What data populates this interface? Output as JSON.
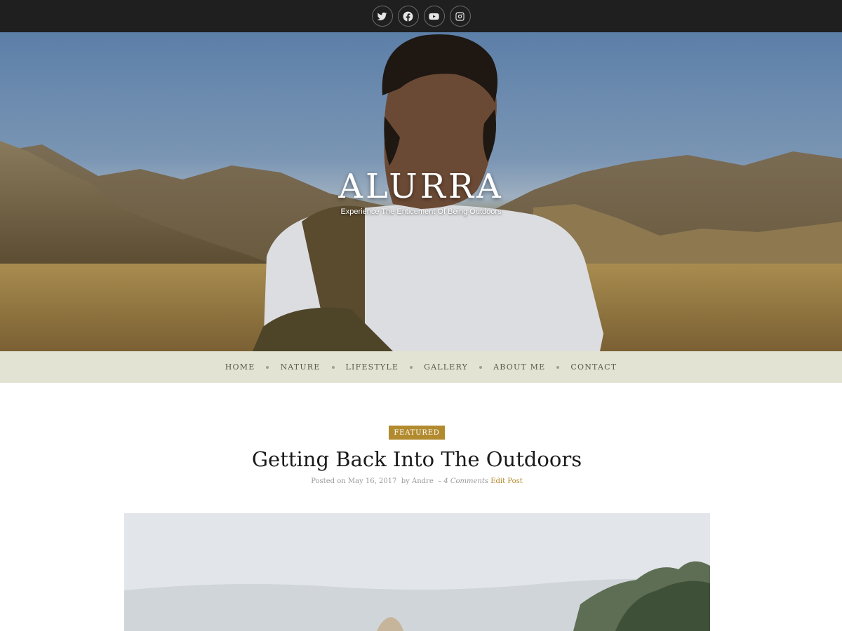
{
  "social": [
    {
      "name": "twitter-icon"
    },
    {
      "name": "facebook-icon"
    },
    {
      "name": "youtube-icon"
    },
    {
      "name": "instagram-icon"
    }
  ],
  "site": {
    "title": "ALURRA",
    "tagline": "Experience The Enticement Of Being Outdoors"
  },
  "nav": {
    "items": [
      {
        "label": "HOME"
      },
      {
        "label": "NATURE"
      },
      {
        "label": "LIFESTYLE"
      },
      {
        "label": "GALLERY"
      },
      {
        "label": "ABOUT ME"
      },
      {
        "label": "CONTACT"
      }
    ]
  },
  "post": {
    "category": "FEATURED",
    "title": "Getting Back Into The Outdoors",
    "posted_on": "Posted on",
    "date": "May 16, 2017",
    "by": "by",
    "author": "Andre",
    "dash": "–",
    "comments": "4 Comments",
    "edit": "Edit Post"
  },
  "colors": {
    "topbar": "#1f1f1f",
    "nav_bg": "#e3e3d4",
    "accent": "#b28b2f"
  }
}
